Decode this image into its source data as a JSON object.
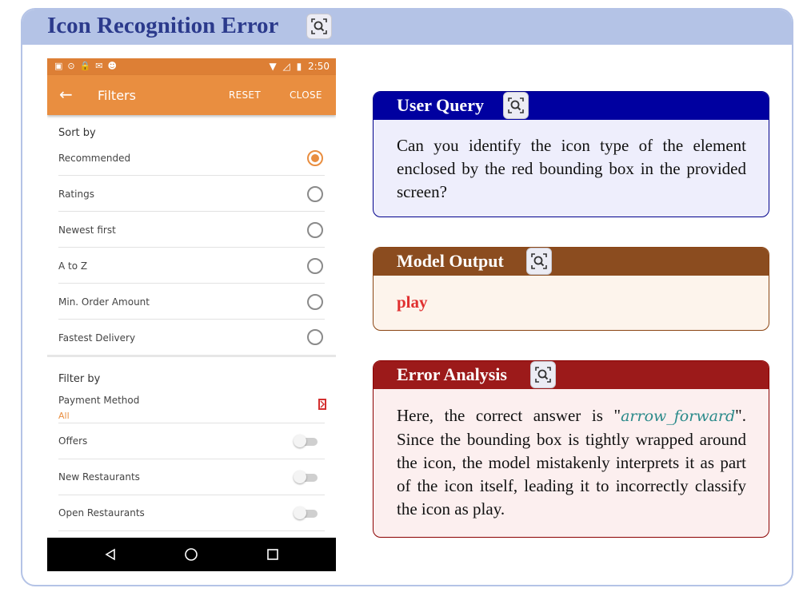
{
  "card": {
    "title": "Icon Recognition Error"
  },
  "phone": {
    "status_time": "2:50",
    "appbar": {
      "title": "Filters",
      "reset": "RESET",
      "close": "CLOSE"
    },
    "sort": {
      "header": "Sort by",
      "options": [
        {
          "label": "Recommended",
          "selected": true
        },
        {
          "label": "Ratings",
          "selected": false
        },
        {
          "label": "Newest first",
          "selected": false
        },
        {
          "label": "A to Z",
          "selected": false
        },
        {
          "label": "Min. Order Amount",
          "selected": false
        },
        {
          "label": "Fastest Delivery",
          "selected": false
        }
      ]
    },
    "filter": {
      "header": "Filter by",
      "payment_label": "Payment Method",
      "payment_value": "All",
      "toggles": [
        {
          "label": "Offers",
          "on": false
        },
        {
          "label": "New Restaurants",
          "on": false
        },
        {
          "label": "Open Restaurants",
          "on": false
        }
      ]
    }
  },
  "query": {
    "title": "User Query",
    "text": "Can you identify the icon type of the element enclosed by the red bounding box in the pro­vided screen?"
  },
  "output": {
    "title": "Model Output",
    "text": "play"
  },
  "error": {
    "title": "Error Analysis",
    "text_before": "Here, the correct answer is \"",
    "answer": "arrow_forward",
    "text_after": "\". Since the bounding box is tightly wrapped around the icon, the model mistakenly inter­prets it as part of the icon itself, leading it to incorrectly classify the icon as play."
  },
  "colors": {
    "card_header": "#b4c3e6",
    "title_text": "#2b3a8c",
    "appbar": "#e98e40",
    "statusbar": "#dd7f35",
    "query_header": "#0000a0",
    "output_header": "#8b4c1f",
    "error_header": "#9c1a1a",
    "bbox": "#d32f2f"
  },
  "icons": [
    "search-zoom-icon",
    "back-arrow-icon",
    "wifi-icon",
    "battery-icon",
    "chevron-right-icon",
    "nav-back-icon",
    "nav-home-icon",
    "nav-recents-icon"
  ]
}
